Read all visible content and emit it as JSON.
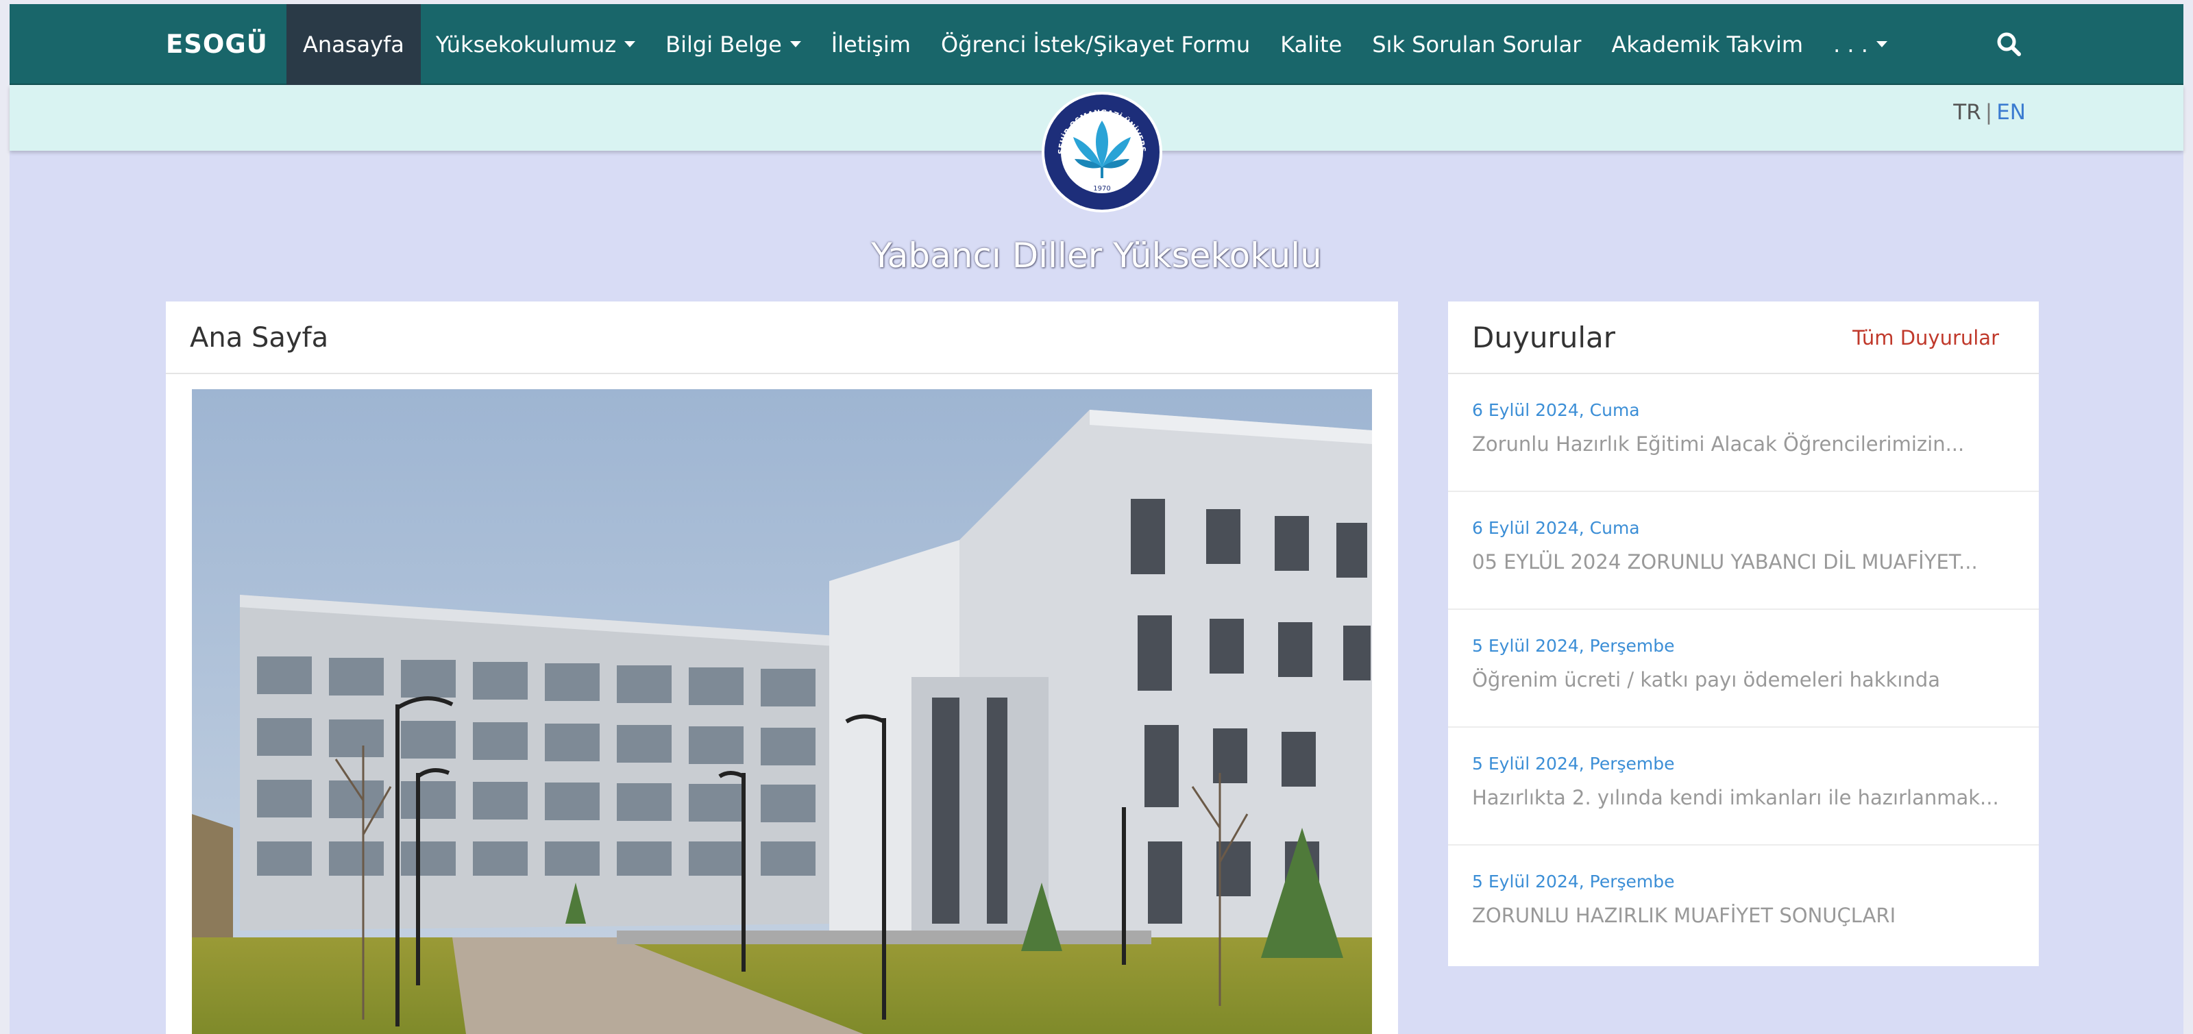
{
  "nav": {
    "brand": "ESOGÜ",
    "items": [
      {
        "label": "Anasayfa",
        "active": true,
        "dropdown": false
      },
      {
        "label": "Yüksekokulumuz",
        "active": false,
        "dropdown": true
      },
      {
        "label": "Bilgi Belge",
        "active": false,
        "dropdown": true
      },
      {
        "label": "İletişim",
        "active": false,
        "dropdown": false
      },
      {
        "label": "Öğrenci İstek/Şikayet Formu",
        "active": false,
        "dropdown": false
      },
      {
        "label": "Kalite",
        "active": false,
        "dropdown": false
      },
      {
        "label": "Sık Sorulan Sorular",
        "active": false,
        "dropdown": false
      },
      {
        "label": "Akademik Takvim",
        "active": false,
        "dropdown": false
      },
      {
        "label": ". . .",
        "active": false,
        "dropdown": true
      }
    ],
    "search_icon": "search-icon"
  },
  "lang": {
    "tr": "TR",
    "separator": "|",
    "en": "EN"
  },
  "logo": {
    "top_text": "ESKİŞEHİR OSMANGAZİ ÜNİVERSİTESİ",
    "year": "1970"
  },
  "site_title": "Yabancı Diller Yüksekokulu",
  "main": {
    "title": "Ana Sayfa"
  },
  "announcements": {
    "title": "Duyurular",
    "all_link": "Tüm Duyurular",
    "items": [
      {
        "date": "6 Eylül 2024, Cuma",
        "text": "Zorunlu Hazırlık Eğitimi Alacak Öğrencilerimizin..."
      },
      {
        "date": "6 Eylül 2024, Cuma",
        "text": "05 EYLÜL 2024 ZORUNLU YABANCI DİL MUAFİYET..."
      },
      {
        "date": "5 Eylül 2024, Perşembe",
        "text": "Öğrenim ücreti / katkı payı ödemeleri hakkında"
      },
      {
        "date": "5 Eylül 2024, Perşembe",
        "text": "Hazırlıkta 2. yılında kendi imkanları ile hazırlanmak..."
      },
      {
        "date": "5 Eylül 2024, Perşembe",
        "text": "ZORUNLU HAZIRLIK MUAFİYET SONUÇLARI"
      }
    ]
  },
  "colors": {
    "navbar": "#19666a",
    "active_nav": "#2a3a47",
    "subbar": "#d9f3f2",
    "page_bg": "#d8dcf5",
    "date_link": "#3b8ed6",
    "all_link": "#c0392b"
  }
}
